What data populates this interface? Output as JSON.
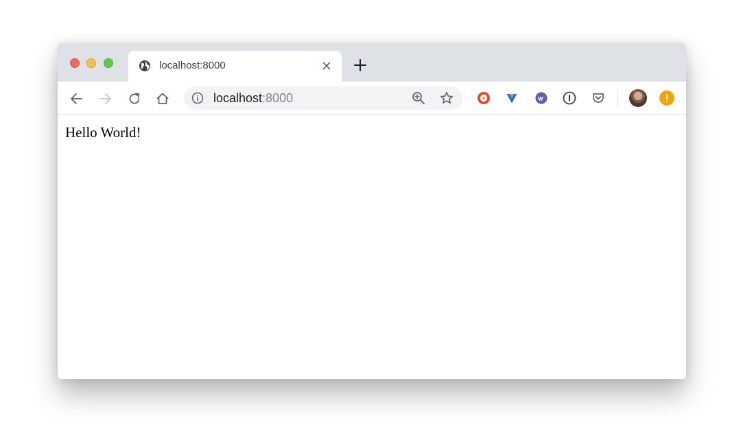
{
  "tab": {
    "title": "localhost:8000"
  },
  "address_bar": {
    "host": "localhost",
    "port": ":8000"
  },
  "page": {
    "body_text": "Hello World!"
  },
  "icons": {
    "tab": [
      "globe-icon",
      "close-icon",
      "plus-icon"
    ],
    "toolbar": [
      "arrow-left-icon",
      "arrow-right-icon",
      "reload-icon",
      "home-icon",
      "info-icon",
      "zoom-icon",
      "star-icon"
    ],
    "extensions": [
      "extension-red-icon",
      "extension-v-icon",
      "extension-wappalyzer-icon",
      "extension-1password-icon",
      "pocket-icon",
      "avatar",
      "profile-alert-icon"
    ]
  },
  "colors": {
    "tabstrip": "#dee1e6",
    "omnibox": "#f1f3f4",
    "close_red": "#ed6a5e",
    "minimize_yellow": "#f5bf4f",
    "zoom_green": "#62c554",
    "profile_orange": "#f0a30a"
  }
}
